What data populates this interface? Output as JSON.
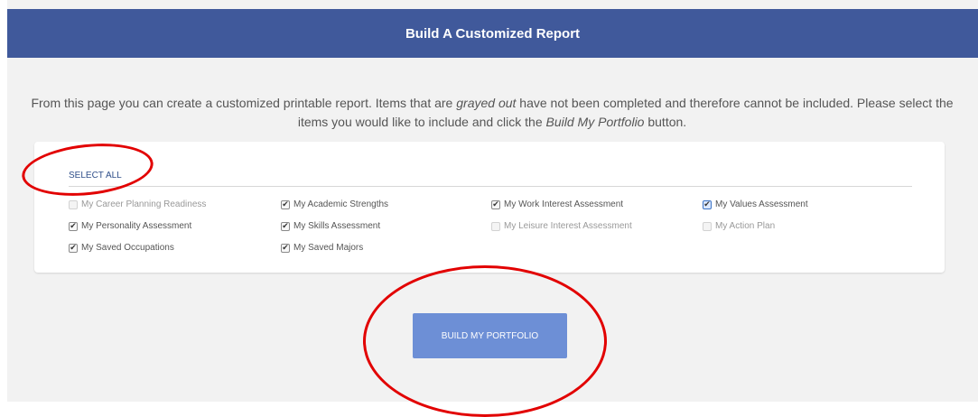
{
  "header": {
    "title": "Build A Customized Report"
  },
  "intro": {
    "part1": "From this page you can create a customized printable report. Items that are ",
    "grayed": "grayed out",
    "part2": " have not been completed and therefore cannot be included. Please select the items you would like to include and click the ",
    "button_ref": "Build My Portfolio",
    "part3": " button."
  },
  "select_all": "SELECT ALL",
  "items": [
    {
      "label": "My Career Planning Readiness",
      "checked": false,
      "disabled": true
    },
    {
      "label": "My Academic Strengths",
      "checked": true,
      "disabled": false
    },
    {
      "label": "My Work Interest Assessment",
      "checked": true,
      "disabled": false
    },
    {
      "label": "My Values Assessment",
      "checked": true,
      "disabled": false,
      "focused": true
    },
    {
      "label": "My Personality Assessment",
      "checked": true,
      "disabled": false
    },
    {
      "label": "My Skills Assessment",
      "checked": true,
      "disabled": false
    },
    {
      "label": "My Leisure Interest Assessment",
      "checked": false,
      "disabled": true
    },
    {
      "label": "My Action Plan",
      "checked": false,
      "disabled": true
    },
    {
      "label": "My Saved Occupations",
      "checked": true,
      "disabled": false
    },
    {
      "label": "My Saved Majors",
      "checked": true,
      "disabled": false
    }
  ],
  "build_button": "BUILD MY PORTFOLIO",
  "colors": {
    "header": "#40599b",
    "button": "#6d8fd6",
    "annotation": "#e20000"
  }
}
